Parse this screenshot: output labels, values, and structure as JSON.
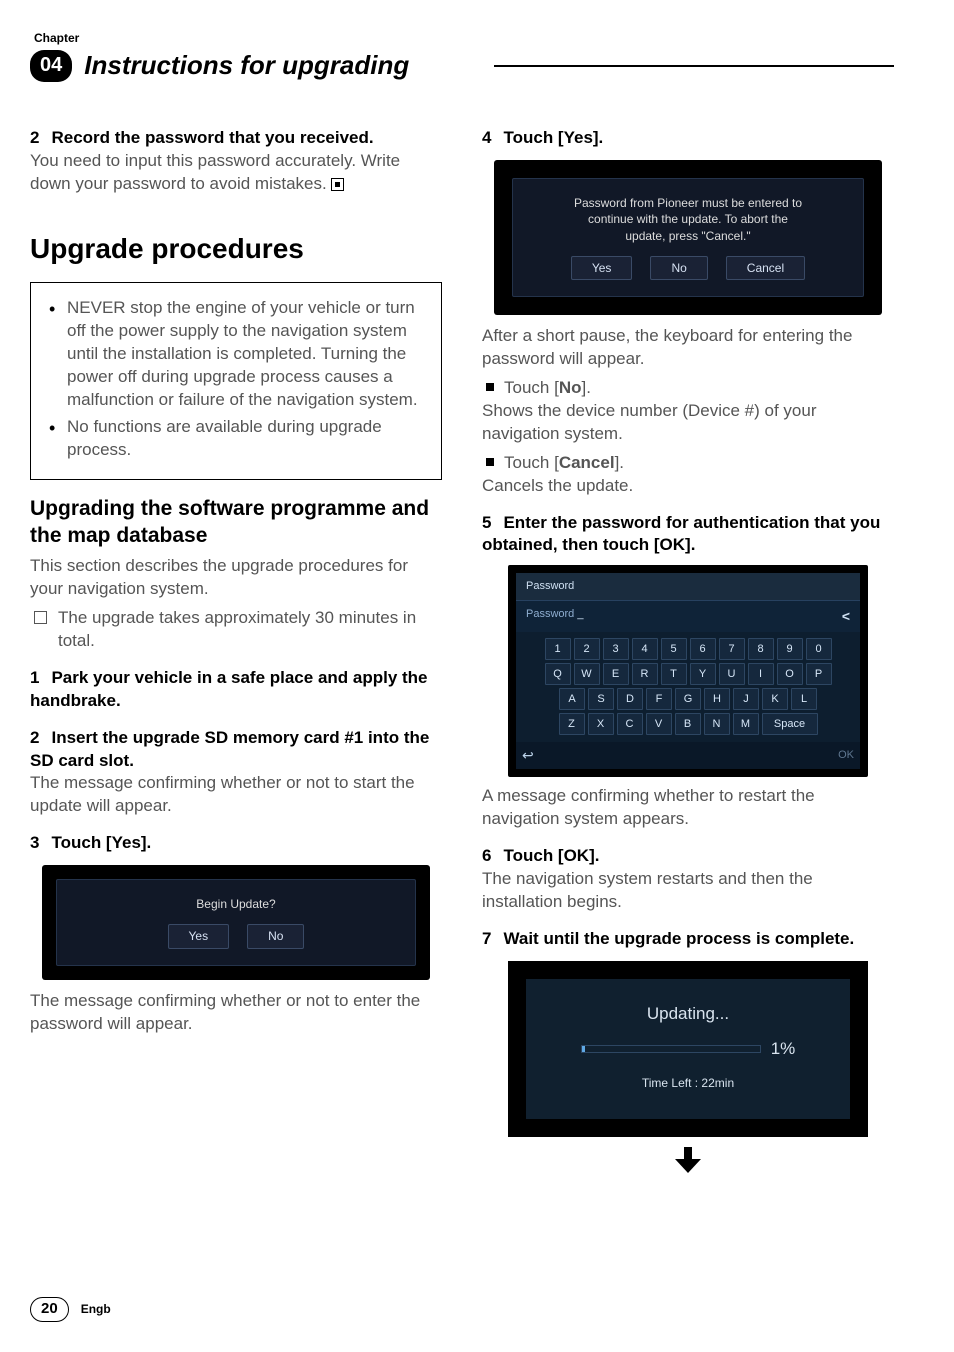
{
  "header": {
    "chapter_label": "Chapter",
    "chapter_num": "04",
    "title": "Instructions for upgrading"
  },
  "left": {
    "step2_head_num": "2",
    "step2_head": "Record the password that you received.",
    "step2_body": "You need to input this password accurately. Write down your password to avoid mistakes.",
    "h1": "Upgrade procedures",
    "warn1": "NEVER stop the engine of your vehicle or turn off the power supply to the navigation system until the installation is completed. Turning the power off during upgrade process causes a malfunction or failure of the navigation system.",
    "warn2": "No functions are available during upgrade process.",
    "h2": "Upgrading the software programme and the map database",
    "h2_body": "This section describes the upgrade procedures for your navigation system.",
    "note1": "The upgrade takes approximately 30 minutes in total.",
    "s1_num": "1",
    "s1": "Park your vehicle in a safe place and apply the handbrake.",
    "s2_num": "2",
    "s2": "Insert the upgrade SD memory card #1 into the SD card slot.",
    "s2_body": "The message confirming whether or not to start the update will appear.",
    "s3_num": "3",
    "s3": "Touch [Yes].",
    "shot1": {
      "msg": "Begin Update?",
      "yes": "Yes",
      "no": "No"
    },
    "s3_after": "The message confirming whether or not to enter the password will appear."
  },
  "right": {
    "s4_num": "4",
    "s4": "Touch [Yes].",
    "shot2": {
      "line1": "Password from Pioneer must be entered to",
      "line2": "continue with the update.  To abort the",
      "line3": "update, press \"Cancel.\"",
      "yes": "Yes",
      "no": "No",
      "cancel": "Cancel"
    },
    "s4_after": "After a short pause, the keyboard for entering the password will appear.",
    "b1_label": "Touch [",
    "b1_bold": "No",
    "b1_end": "].",
    "b1_body": "Shows the device number (Device #) of your navigation system.",
    "b2_label": "Touch [",
    "b2_bold": "Cancel",
    "b2_end": "].",
    "b2_body": "Cancels the update.",
    "s5_num": "5",
    "s5": "Enter the password for authentication that you obtained, then touch [OK].",
    "kbd": {
      "title": "Password",
      "field_label": "Password",
      "cursor": "_",
      "back": "<",
      "row1": [
        "1",
        "2",
        "3",
        "4",
        "5",
        "6",
        "7",
        "8",
        "9",
        "0"
      ],
      "row2": [
        "Q",
        "W",
        "E",
        "R",
        "T",
        "Y",
        "U",
        "I",
        "O",
        "P"
      ],
      "row3": [
        "A",
        "S",
        "D",
        "F",
        "G",
        "H",
        "J",
        "K",
        "L"
      ],
      "row4": [
        "Z",
        "X",
        "C",
        "V",
        "B",
        "N",
        "M"
      ],
      "space": "Space",
      "return": "↩",
      "ok": "OK"
    },
    "s5_after": "A message confirming whether to restart the navigation system appears.",
    "s6_num": "6",
    "s6": "Touch [OK].",
    "s6_body": "The navigation system restarts and then the installation begins.",
    "s7_num": "7",
    "s7": "Wait until the upgrade process is complete.",
    "update": {
      "title": "Updating...",
      "pct": "1%",
      "time": "Time Left  :  22min"
    }
  },
  "footer": {
    "page": "20",
    "lang": "Engb"
  }
}
